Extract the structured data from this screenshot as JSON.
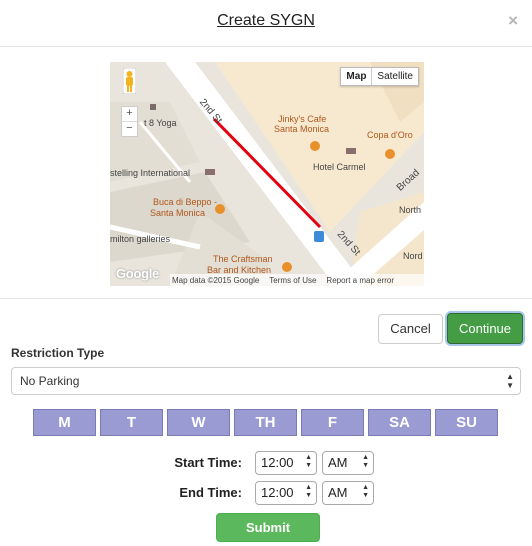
{
  "dialog": {
    "title": "Create SYGN",
    "close_label": "×"
  },
  "map": {
    "type_buttons": {
      "map": "Map",
      "satellite": "Satellite"
    },
    "zoom": {
      "in": "+",
      "out": "−"
    },
    "labels": {
      "yoga": "t 8 Yoga",
      "stelling": "stelling International",
      "buca1": "Buca di Beppo -",
      "buca2": "Santa Monica",
      "hamilton": "milton galleries",
      "craftsman1": "The Craftsman",
      "craftsman2": "Bar and Kitchen",
      "jinky1": "Jinky's Cafe",
      "jinky2": "Santa Monica",
      "hotel": "Hotel Carmel",
      "copa": "Copa d'Oro",
      "north": "North",
      "nord": "Nord",
      "street_2nd_top": "2nd St",
      "street_2nd_bottom": "2nd St",
      "broadway": "Broad"
    },
    "google": "Google",
    "footer": {
      "data": "Map data ©2015 Google",
      "terms": "Terms of Use",
      "report": "Report a map error"
    }
  },
  "buttons": {
    "cancel": "Cancel",
    "continue": "Continue",
    "submit": "Submit"
  },
  "restriction": {
    "label": "Restriction Type",
    "value": "No Parking"
  },
  "days": [
    "M",
    "T",
    "W",
    "TH",
    "F",
    "SA",
    "SU"
  ],
  "start_time": {
    "label": "Start Time:",
    "time": "12:00",
    "ampm": "AM"
  },
  "end_time": {
    "label": "End Time:",
    "time": "12:00",
    "ampm": "AM"
  },
  "colors": {
    "accent_green": "#449d44",
    "submit_green": "#5cb85c",
    "day_purple": "#9b9bd4",
    "route_red": "#e3000f"
  }
}
